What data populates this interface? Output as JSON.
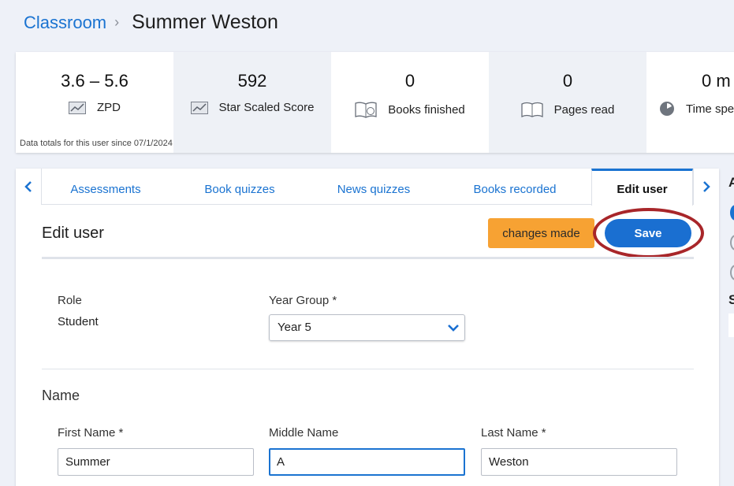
{
  "breadcrumb": {
    "parent": "Classroom",
    "separator": "›",
    "current": "Summer Weston"
  },
  "stats": {
    "items": [
      {
        "value": "3.6 – 5.6",
        "label": "ZPD",
        "icon": "chart-icon"
      },
      {
        "value": "592",
        "label": "Star Scaled Score",
        "icon": "chart-icon"
      },
      {
        "value": "0",
        "label": "Books finished",
        "icon": "book-fin-icon"
      },
      {
        "value": "0",
        "label": "Pages read",
        "icon": "open-book-icon"
      },
      {
        "value": "0 m",
        "label": "Time spe",
        "icon": "clock-icon"
      }
    ],
    "note": "Data totals for this user since 07/1/2024"
  },
  "tabs": {
    "items": [
      "Assessments",
      "Book quizzes",
      "News quizzes",
      "Books recorded",
      "Edit user"
    ],
    "active": "Edit user"
  },
  "edit": {
    "title": "Edit user",
    "changes_label": "changes made",
    "save_label": "Save",
    "role_label": "Role",
    "role_value": "Student",
    "year_label": "Year Group *",
    "year_value": "Year 5",
    "name_section": "Name",
    "first_label": "First Name *",
    "first_value": "Summer",
    "middle_label": "Middle Name",
    "middle_value": "A",
    "last_label": "Last Name *",
    "last_value": "Weston"
  },
  "side": {
    "letter_a": "A",
    "letter_s": "S"
  },
  "colors": {
    "accent": "#1a73d1",
    "warning": "#f7a233",
    "highlight_ring": "#a8262a"
  }
}
